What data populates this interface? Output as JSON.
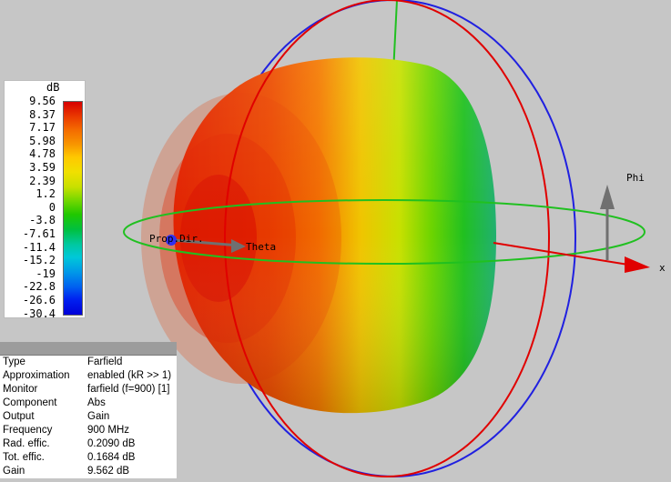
{
  "legend": {
    "unit": "dB",
    "ticks": [
      "9.56",
      "8.37",
      "7.17",
      "5.98",
      "4.78",
      "3.59",
      "2.39",
      "1.2",
      "0",
      "-3.8",
      "-7.61",
      "-11.4",
      "-15.2",
      "-19",
      "-22.8",
      "-26.6",
      "-30.4"
    ]
  },
  "axes": {
    "phi_label": "Phi",
    "theta_label": "Theta",
    "x_label": "x",
    "prop_dir_label": "Prop.Dir."
  },
  "info": {
    "rows": [
      {
        "key": "Type",
        "value": "Farfield"
      },
      {
        "key": "Approximation",
        "value": "enabled (kR >> 1)"
      },
      {
        "key": "Monitor",
        "value": "farfield (f=900) [1]"
      },
      {
        "key": "Component",
        "value": "Abs"
      },
      {
        "key": "Output",
        "value": "Gain"
      },
      {
        "key": "Frequency",
        "value": "900 MHz"
      },
      {
        "key": "Rad. effic.",
        "value": "0.2090 dB"
      },
      {
        "key": "Tot. effic.",
        "value": "0.1684 dB"
      },
      {
        "key": "Gain",
        "value": "9.562 dB"
      }
    ]
  },
  "colors": {
    "background": "#c6c6c6",
    "x_axis": "#e00000",
    "y_axis": "#2020e0",
    "z_axis": "#20c020",
    "arrow_gray": "#707070"
  }
}
